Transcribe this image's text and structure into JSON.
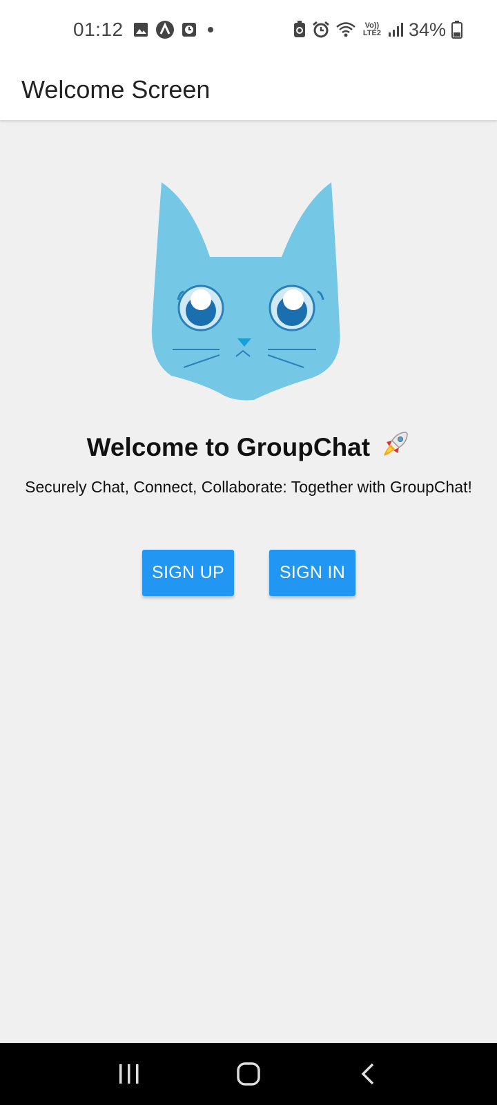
{
  "status_bar": {
    "time": "01:12",
    "left_icons": [
      "image-icon",
      "app-a-icon",
      "clock-badge-icon",
      "dot-icon"
    ],
    "right_icons": [
      "battery-saver-icon",
      "alarm-icon",
      "wifi-icon",
      "volte-icon",
      "signal-icon",
      "battery-icon"
    ],
    "volte_label": "Vo)) LTE2",
    "battery_percent": "34%",
    "battery_level": 0.34
  },
  "app_bar": {
    "title": "Welcome Screen"
  },
  "main": {
    "logo_icon": "cat-logo-icon",
    "welcome_title": "Welcome to GroupChat",
    "welcome_emoji_icon": "rocket-icon",
    "tagline": "Securely Chat, Connect, Collaborate: Together with GroupChat!",
    "signup_label": "SIGN UP",
    "signin_label": "SIGN IN"
  },
  "nav_bar": {
    "icons": [
      "recent-apps-icon",
      "home-icon",
      "back-icon"
    ]
  },
  "colors": {
    "button": "#2196f3",
    "cat": "#74c8e6",
    "background": "#f0f0f0"
  }
}
